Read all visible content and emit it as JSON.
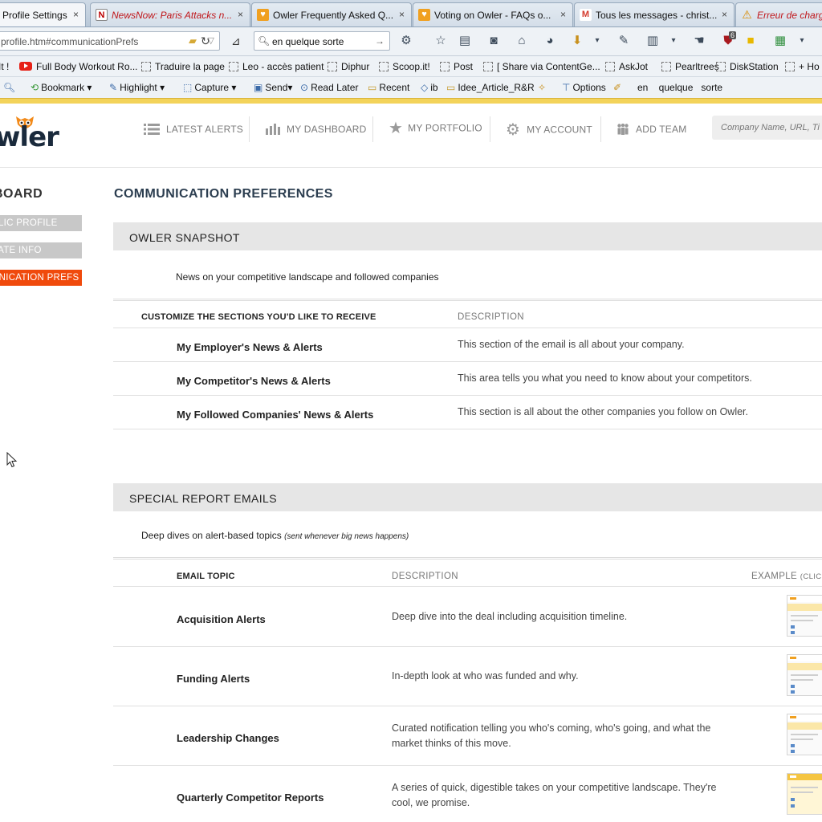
{
  "browser": {
    "tabs": [
      {
        "title": "Profile Settings",
        "icon": "owler-favicon",
        "active": true
      },
      {
        "title": "NewsNow: Paris Attacks n...",
        "icon": "newsnow-favicon",
        "active": false
      },
      {
        "title": "Owler Frequently Asked Q...",
        "icon": "owler-favicon",
        "active": false
      },
      {
        "title": "Voting on Owler - FAQs o...",
        "icon": "owler-favicon",
        "active": false
      },
      {
        "title": "Tous les messages - christ...",
        "icon": "gmail-favicon",
        "active": false
      },
      {
        "title": "Erreur de charge",
        "icon": "warning-icon",
        "active": false
      }
    ],
    "tab_close": "×",
    "address": "profile.htm#communicationPrefs",
    "search_value": "en quelque sorte",
    "badge_count": "6",
    "bookmarks": [
      {
        "label": "It !"
      },
      {
        "label": "Full Body Workout Ro..."
      },
      {
        "label": "Traduire la page"
      },
      {
        "label": "Leo - accès patient"
      },
      {
        "label": "Diphur"
      },
      {
        "label": "Scoop.it!"
      },
      {
        "label": "Post"
      },
      {
        "label": "[ Share via ContentGe..."
      },
      {
        "label": "AskJot"
      },
      {
        "label": "Pearltrees"
      },
      {
        "label": "DiskStation"
      },
      {
        "label": "+ Ho"
      }
    ],
    "toolbar2": {
      "bookmark": "Bookmark",
      "highlight": "Highlight",
      "capture": "Capture",
      "send": "Send",
      "read_later": "Read Later",
      "recent": "Recent",
      "ib": "ib",
      "idee": "Idee_Article_R&R",
      "options": "Options",
      "search_terms": "en    quelque   sorte"
    }
  },
  "owler": {
    "logo": "wler",
    "nav": [
      {
        "label": "LATEST ALERTS",
        "icon": "list-icon"
      },
      {
        "label": "MY DASHBOARD",
        "icon": "bar-chart-icon"
      },
      {
        "label": "MY PORTFOLIO",
        "icon": "star-icon"
      },
      {
        "label": "MY ACCOUNT",
        "icon": "gear-icon"
      },
      {
        "label": "ADD TEAM",
        "icon": "team-icon"
      }
    ],
    "search_placeholder": "Company Name, URL, Ti"
  },
  "sidebar": {
    "title": "BOARD",
    "items": [
      {
        "label": "BLIC PROFILE",
        "state": "inactive"
      },
      {
        "label": "VATE INFO",
        "state": "inactive"
      },
      {
        "label": "UNICATION PREFS",
        "state": "active"
      }
    ]
  },
  "main": {
    "title": "COMMUNICATION PREFERENCES",
    "snapshot": {
      "heading": "OWLER SNAPSHOT",
      "intro": "News on your competitive landscape and followed companies",
      "col_section": "CUSTOMIZE THE SECTIONS YOU'D LIKE TO RECEIVE",
      "col_description": "DESCRIPTION",
      "rows": [
        {
          "label": "My Employer's News & Alerts",
          "description": "This section of the email is all about your company."
        },
        {
          "label": "My Competitor's News & Alerts",
          "description": "This area tells you what you need to know about your competitors."
        },
        {
          "label": "My Followed Companies' News & Alerts",
          "description": "This section is all about the other companies you follow on Owler."
        }
      ]
    },
    "special": {
      "heading": "SPECIAL REPORT EMAILS",
      "intro": "Deep dives on alert-based topics",
      "intro_note": "(sent whenever big news happens)",
      "col_topic": "EMAIL TOPIC",
      "col_description": "DESCRIPTION",
      "col_example": "EXAMPLE",
      "col_example_note": "(CLICK",
      "rows": [
        {
          "label": "Acquisition Alerts",
          "description": "Deep dive into the deal including acquisition timeline."
        },
        {
          "label": "Funding Alerts",
          "description": "In-depth look at who was funded and why."
        },
        {
          "label": "Leadership Changes",
          "description": "Curated notification telling you who's coming, who's going, and what the market thinks of this move."
        },
        {
          "label": "Quarterly Competitor Reports",
          "description": "A series of quick, digestible takes on your competitive landscape. They're cool, we promise."
        }
      ]
    }
  },
  "colors": {
    "accent": "#f04a0c",
    "band": "#e6e6e6",
    "brand_navy": "#1a2a3c"
  }
}
